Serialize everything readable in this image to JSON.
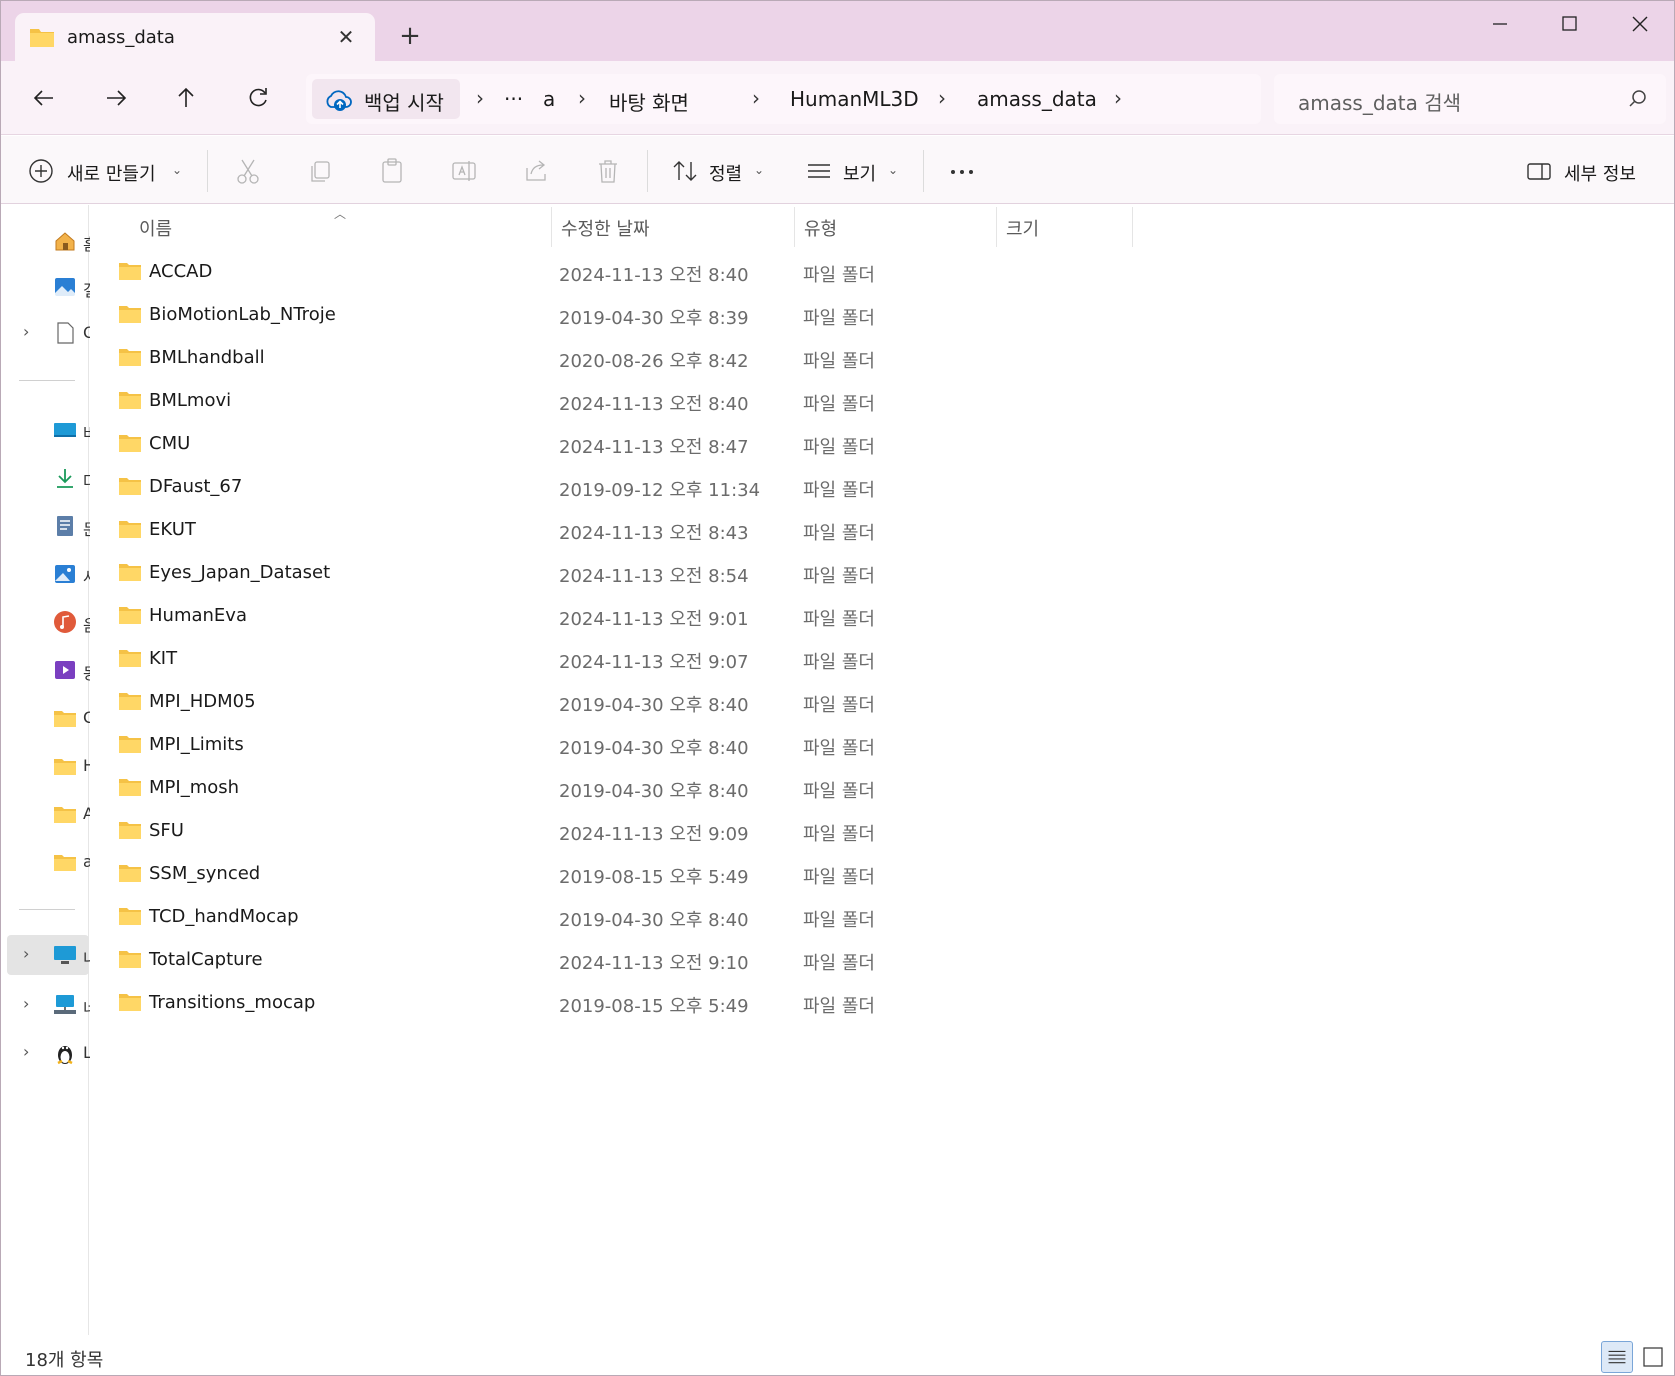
{
  "tab": {
    "title": "amass_data",
    "close_label": "✕",
    "new_tab_label": "+"
  },
  "address": {
    "backup_label": "백업 시작",
    "breadcrumbs": [
      "···",
      "a",
      "바탕 화면",
      "HumanML3D",
      "amass_data"
    ]
  },
  "search": {
    "placeholder": "amass_data 검색"
  },
  "commands": {
    "new_label": "새로 만들기",
    "sort_label": "정렬",
    "view_label": "보기",
    "details_label": "세부 정보"
  },
  "columns": {
    "name": "이름",
    "date": "수정한 날짜",
    "type": "유형",
    "size": "크기"
  },
  "files": [
    {
      "name": "ACCAD",
      "date": "2024-11-13 오전 8:40",
      "type": "파일 폴더"
    },
    {
      "name": "BioMotionLab_NTroje",
      "date": "2019-04-30 오후 8:39",
      "type": "파일 폴더"
    },
    {
      "name": "BMLhandball",
      "date": "2020-08-26 오후 8:42",
      "type": "파일 폴더"
    },
    {
      "name": "BMLmovi",
      "date": "2024-11-13 오전 8:40",
      "type": "파일 폴더"
    },
    {
      "name": "CMU",
      "date": "2024-11-13 오전 8:47",
      "type": "파일 폴더"
    },
    {
      "name": "DFaust_67",
      "date": "2019-09-12 오후 11:34",
      "type": "파일 폴더"
    },
    {
      "name": "EKUT",
      "date": "2024-11-13 오전 8:43",
      "type": "파일 폴더"
    },
    {
      "name": "Eyes_Japan_Dataset",
      "date": "2024-11-13 오전 8:54",
      "type": "파일 폴더"
    },
    {
      "name": "HumanEva",
      "date": "2024-11-13 오전 9:01",
      "type": "파일 폴더"
    },
    {
      "name": "KIT",
      "date": "2024-11-13 오전 9:07",
      "type": "파일 폴더"
    },
    {
      "name": "MPI_HDM05",
      "date": "2019-04-30 오후 8:40",
      "type": "파일 폴더"
    },
    {
      "name": "MPI_Limits",
      "date": "2019-04-30 오후 8:40",
      "type": "파일 폴더"
    },
    {
      "name": "MPI_mosh",
      "date": "2019-04-30 오후 8:40",
      "type": "파일 폴더"
    },
    {
      "name": "SFU",
      "date": "2024-11-13 오전 9:09",
      "type": "파일 폴더"
    },
    {
      "name": "SSM_synced",
      "date": "2019-08-15 오후 5:49",
      "type": "파일 폴더"
    },
    {
      "name": "TCD_handMocap",
      "date": "2019-04-30 오후 8:40",
      "type": "파일 폴더"
    },
    {
      "name": "TotalCapture",
      "date": "2024-11-13 오전 9:10",
      "type": "파일 폴더"
    },
    {
      "name": "Transitions_mocap",
      "date": "2019-08-15 오후 5:49",
      "type": "파일 폴더"
    }
  ],
  "sidebar": {
    "items": [
      {
        "icon": "home-icon",
        "fragment": "홈"
      },
      {
        "icon": "gallery-icon",
        "fragment": "갤"
      },
      {
        "icon": "document-icon",
        "fragment": "O"
      },
      {
        "icon": "desktop-icon",
        "fragment": "바"
      },
      {
        "icon": "download-icon",
        "fragment": "다"
      },
      {
        "icon": "documents-icon",
        "fragment": "문"
      },
      {
        "icon": "pictures-icon",
        "fragment": "사"
      },
      {
        "icon": "music-icon",
        "fragment": "음"
      },
      {
        "icon": "videos-icon",
        "fragment": "동"
      },
      {
        "icon": "folder-icon",
        "fragment": "C"
      },
      {
        "icon": "folder-icon",
        "fragment": "H"
      },
      {
        "icon": "folder-icon",
        "fragment": "A"
      },
      {
        "icon": "folder-icon",
        "fragment": "a"
      },
      {
        "icon": "this-pc-icon",
        "fragment": "내"
      },
      {
        "icon": "network-icon",
        "fragment": "네"
      },
      {
        "icon": "linux-icon",
        "fragment": "L"
      }
    ]
  },
  "status": {
    "item_count": "18개 항목"
  },
  "colors": {
    "titlebar": "#ecd4e8",
    "navbar": "#faf2f8",
    "folder": "#f5c246",
    "accent": "#0067c0"
  }
}
